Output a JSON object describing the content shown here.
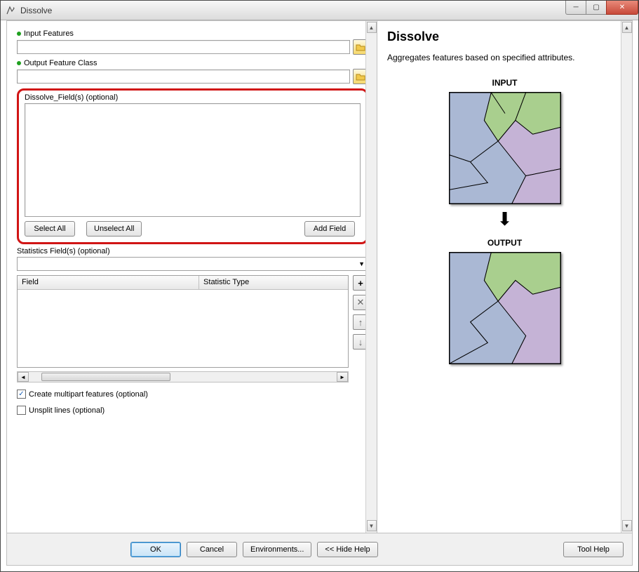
{
  "window": {
    "title": "Dissolve"
  },
  "winbtns": {
    "min": "─",
    "max": "▢",
    "close": "✕"
  },
  "params": {
    "input_features_label": "Input Features",
    "output_feature_class_label": "Output Feature Class",
    "dissolve_fields_label": "Dissolve_Field(s) (optional)",
    "statistics_fields_label": "Statistics Field(s) (optional)"
  },
  "buttons": {
    "select_all": "Select All",
    "unselect_all": "Unselect All",
    "add_field": "Add Field",
    "ok": "OK",
    "cancel": "Cancel",
    "environments": "Environments...",
    "hide_help": "<< Hide Help",
    "tool_help": "Tool Help"
  },
  "stats_table": {
    "col_field": "Field",
    "col_stat": "Statistic Type"
  },
  "sidebuttons": {
    "add": "+",
    "remove": "✕",
    "up": "↑",
    "down": "↓"
  },
  "checkboxes": {
    "multipart": {
      "label": "Create multipart features (optional)",
      "checked": true
    },
    "unsplit": {
      "label": "Unsplit lines (optional)",
      "checked": false
    }
  },
  "help": {
    "title": "Dissolve",
    "description": "Aggregates features based on specified attributes.",
    "input_label": "INPUT",
    "output_label": "OUTPUT"
  },
  "colors": {
    "highlight_red": "#d11515",
    "map_blue": "#aab8d4",
    "map_green": "#a9cf8e",
    "map_purple": "#c5b3d6"
  }
}
